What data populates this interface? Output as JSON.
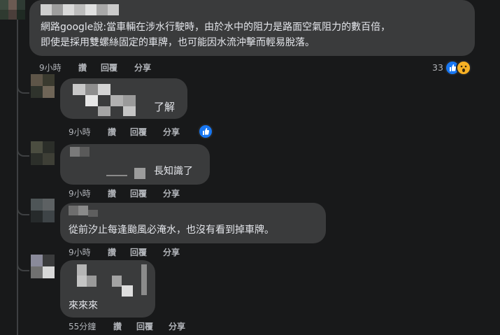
{
  "comments": [
    {
      "text_line1": "網路google說:當車輛在涉水行駛時，由於水中的阻力是路面空氣阻力的數百倍，",
      "text_line2": "即使是採用雙螺絲固定的車牌，也可能因水流沖擊而輕易脫落。",
      "time": "9小時",
      "like": "讚",
      "reply": "回覆",
      "share": "分享",
      "reaction_count": "33",
      "reactions": [
        "like-icon",
        "wow-icon"
      ]
    },
    {
      "text": "了解",
      "time": "9小時",
      "like": "讚",
      "reply": "回覆",
      "share": "分享",
      "reactions": [
        "like-icon"
      ]
    },
    {
      "text": "長知識了",
      "time": "9小時",
      "like": "讚",
      "reply": "回覆",
      "share": "分享"
    },
    {
      "text": "從前汐止每逢颱風必淹水，也沒有看到掉車牌。",
      "time": "9小時",
      "like": "讚",
      "reply": "回覆",
      "share": "分享"
    },
    {
      "text": "來來來",
      "time": "55分鐘",
      "like": "讚",
      "reply": "回覆",
      "share": "分享"
    }
  ],
  "colors": {
    "background": "#18191a",
    "bubble": "#3a3b3c",
    "text": "#e4e6eb",
    "meta": "#b0b3b8",
    "like_blue": "#1877f2",
    "wow_yellow": "#f7b125"
  }
}
